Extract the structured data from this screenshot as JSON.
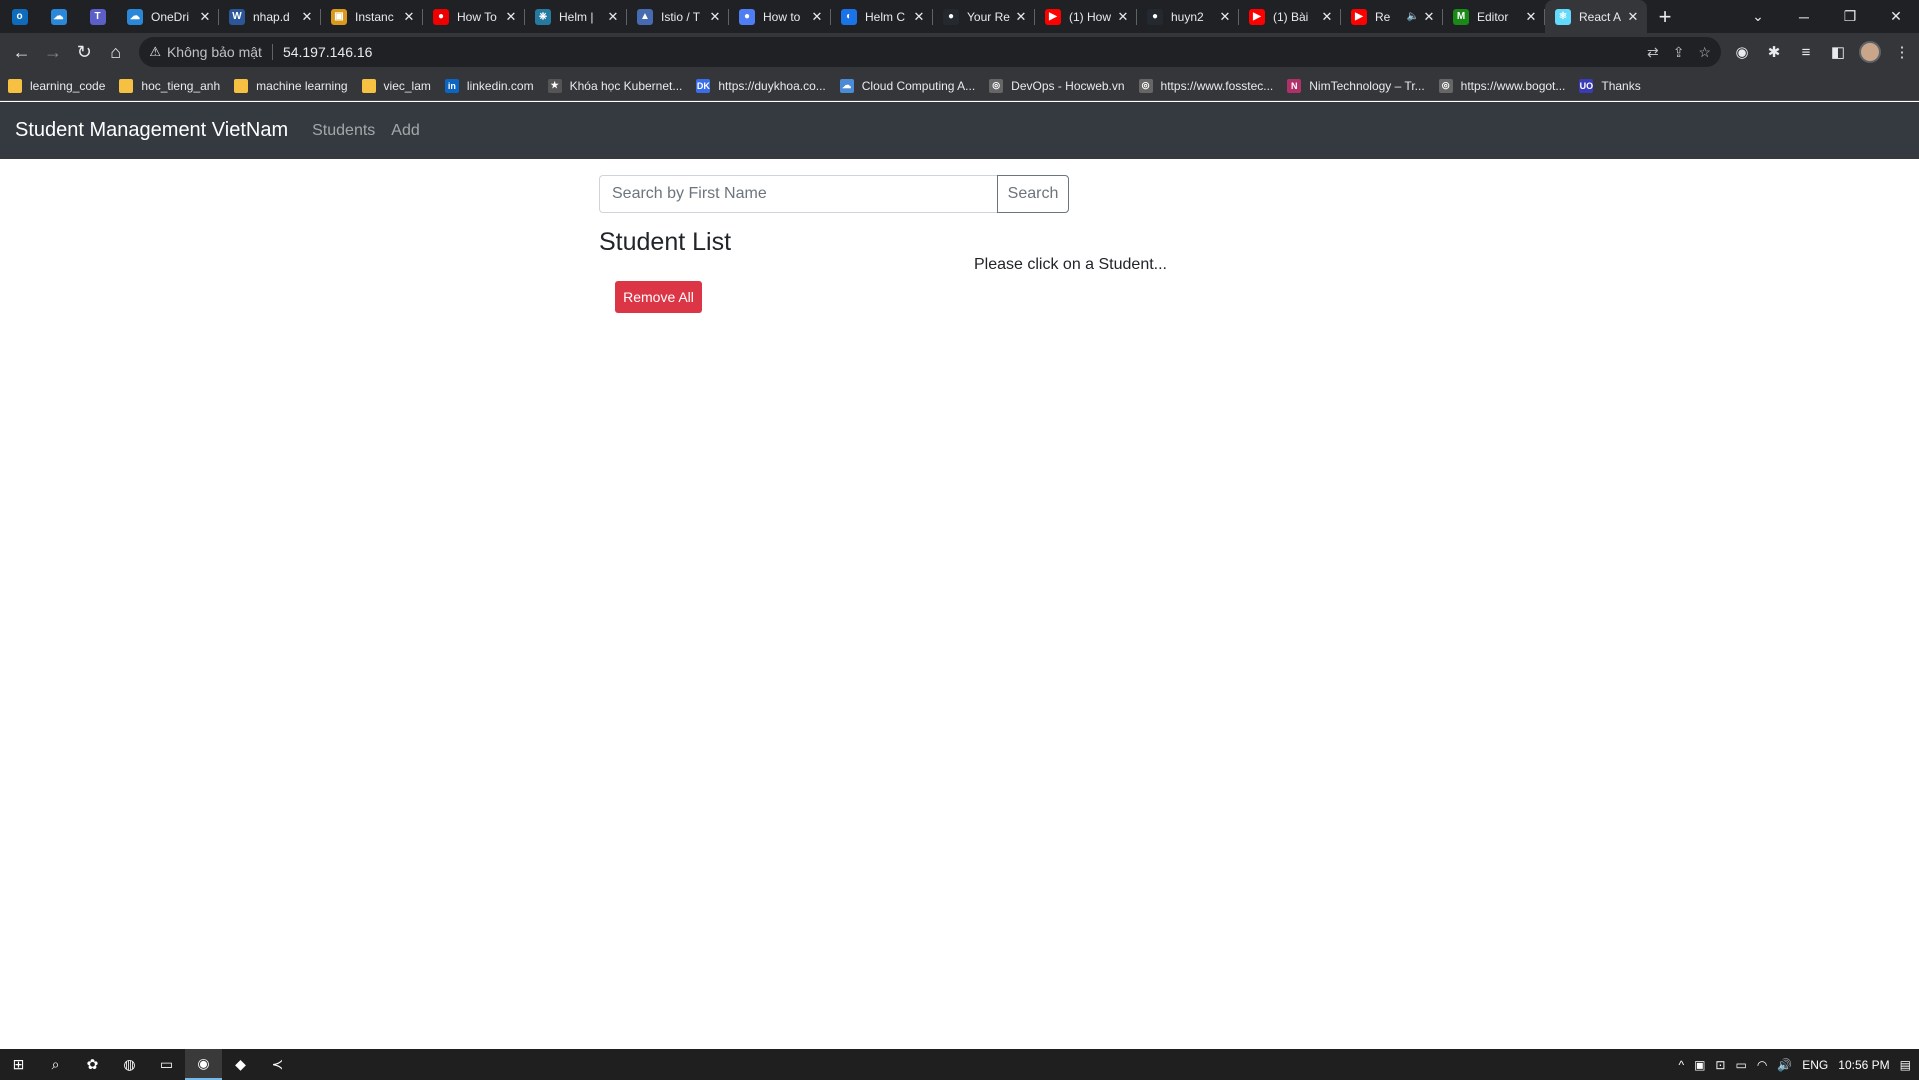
{
  "browser": {
    "pinned_tabs": [
      {
        "icon": "outlook-icon",
        "glyph": "o",
        "color": "#0f6cbd"
      },
      {
        "icon": "onedrive-icon",
        "glyph": "☁",
        "color": "#2b88d8"
      },
      {
        "icon": "teams-icon",
        "glyph": "T",
        "color": "#5b5fc7"
      }
    ],
    "tabs": [
      {
        "title": "OneDri",
        "icon": "onedrive-icon",
        "glyph": "☁",
        "color": "#2b88d8"
      },
      {
        "title": "nhap.d",
        "icon": "word-icon",
        "glyph": "W",
        "color": "#2b579a"
      },
      {
        "title": "Instanc",
        "icon": "aws-icon",
        "glyph": "▣",
        "color": "#d99a1c"
      },
      {
        "title": "How To",
        "icon": "redhat-icon",
        "glyph": "●",
        "color": "#ee0000"
      },
      {
        "title": "Helm |",
        "icon": "helm-icon",
        "glyph": "⎈",
        "color": "#277a9f"
      },
      {
        "title": "Istio / T",
        "icon": "istio-icon",
        "glyph": "▲",
        "color": "#466bb0"
      },
      {
        "title": "How to",
        "icon": "site-icon",
        "glyph": "●",
        "color": "#4f7df3"
      },
      {
        "title": "Helm C",
        "icon": "helm-chart-icon",
        "glyph": "◐",
        "color": "#1a73e8"
      },
      {
        "title": "Your Re",
        "icon": "github-icon",
        "glyph": "●",
        "color": "#24292f"
      },
      {
        "title": "(1) How",
        "icon": "youtube-icon",
        "glyph": "▶",
        "color": "#ff0000"
      },
      {
        "title": "huyn2",
        "icon": "github-icon",
        "glyph": "●",
        "color": "#24292f"
      },
      {
        "title": "(1) Bài",
        "icon": "youtube-icon",
        "glyph": "▶",
        "color": "#ff0000"
      },
      {
        "title": "Re",
        "icon": "youtube-icon",
        "glyph": "▶",
        "color": "#ff0000",
        "audio": "🔈"
      },
      {
        "title": "Editor",
        "icon": "medium-icon",
        "glyph": "M",
        "color": "#1a8917"
      },
      {
        "title": "React A",
        "icon": "react-icon",
        "glyph": "⚛",
        "color": "#61dafb",
        "active": true
      }
    ],
    "close_glyph": "✕",
    "new_tab_glyph": "+",
    "tab_list_glyph": "⌄",
    "window": {
      "minimize": "─",
      "restore": "❐",
      "close": "✕"
    },
    "nav": {
      "back": "←",
      "forward": "→",
      "reload": "↻",
      "home": "⌂"
    },
    "omnibox": {
      "warning_glyph": "⚠",
      "security_text": "Không bảo mật",
      "url": "54.197.146.16",
      "translate_glyph": "⇄",
      "share_glyph": "⇪",
      "star_glyph": "☆"
    },
    "toolbar_icons": [
      {
        "name": "extension-circle-icon",
        "glyph": "◉"
      },
      {
        "name": "extensions-puzzle-icon",
        "glyph": "✱"
      },
      {
        "name": "media-control-icon",
        "glyph": "≡"
      },
      {
        "name": "side-panel-icon",
        "glyph": "◧"
      }
    ],
    "menu_glyph": "⋮",
    "bookmarks": [
      {
        "label": "learning_code",
        "type": "folder"
      },
      {
        "label": "hoc_tieng_anh",
        "type": "folder"
      },
      {
        "label": "machine learning",
        "type": "folder"
      },
      {
        "label": "viec_lam",
        "type": "folder"
      },
      {
        "label": "linkedin.com",
        "type": "site",
        "glyph": "in",
        "color": "#0a66c2"
      },
      {
        "label": "Khóa học Kubernet...",
        "type": "site",
        "glyph": "★",
        "color": "#555555"
      },
      {
        "label": "https://duykhoa.co...",
        "type": "site",
        "glyph": "DK",
        "color": "#3a6ee8"
      },
      {
        "label": "Cloud Computing A...",
        "type": "site",
        "glyph": "☁",
        "color": "#4b8bd6"
      },
      {
        "label": "DevOps - Hocweb.vn",
        "type": "site",
        "glyph": "◎",
        "color": "#666666"
      },
      {
        "label": "https://www.fosstec...",
        "type": "site",
        "glyph": "◎",
        "color": "#666666"
      },
      {
        "label": "NimTechnology – Tr...",
        "type": "site",
        "glyph": "N",
        "color": "#b0306a"
      },
      {
        "label": "https://www.bogot...",
        "type": "site",
        "glyph": "◎",
        "color": "#666666"
      },
      {
        "label": "Thanks",
        "type": "site",
        "glyph": "UO",
        "color": "#3b3bb8"
      }
    ]
  },
  "app": {
    "brand": "Student Management VietNam",
    "nav_links": [
      "Students",
      "Add"
    ],
    "search": {
      "placeholder": "Search by First Name",
      "button": "Search"
    },
    "list_title": "Student List",
    "remove_all": "Remove All",
    "hint": "Please click on a Student..."
  },
  "taskbar": {
    "apps": [
      {
        "name": "windows-start-icon",
        "glyph": "⊞"
      },
      {
        "name": "search-icon",
        "glyph": "⌕"
      },
      {
        "name": "app-icon",
        "glyph": "✿"
      },
      {
        "name": "zoom-icon",
        "glyph": "◍"
      },
      {
        "name": "file-explorer-icon",
        "glyph": "▭"
      },
      {
        "name": "chrome-icon",
        "glyph": "◉",
        "active": true
      },
      {
        "name": "git-icon",
        "glyph": "◆"
      },
      {
        "name": "vscode-icon",
        "glyph": "≺"
      }
    ],
    "tray": {
      "chevron": "^",
      "language": "ENG",
      "time": "10:56 PM",
      "icons": [
        "▣",
        "⊡",
        "▭",
        "◠",
        "🔊"
      ],
      "notification_glyph": "▤"
    }
  }
}
